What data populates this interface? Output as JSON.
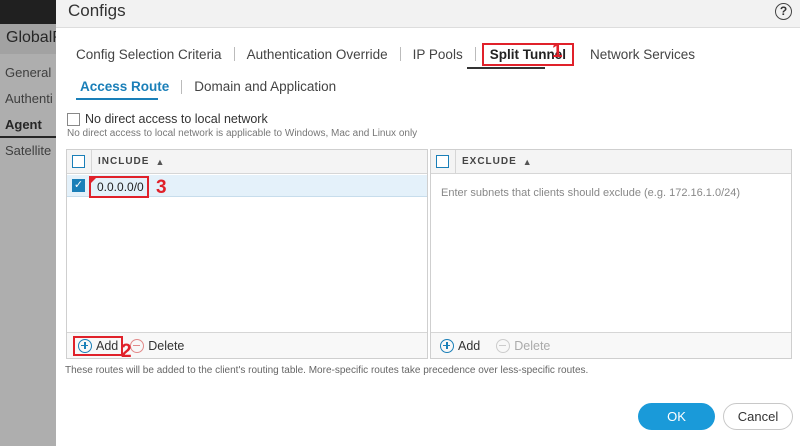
{
  "background_app": {
    "title": "GlobalP",
    "tabs": [
      "General",
      "Authenti",
      "Agent",
      "Satellite"
    ],
    "active_tab": "Agent"
  },
  "dialog": {
    "title": "Configs",
    "help_symbol": "?",
    "tabs": [
      {
        "label": "Config Selection Criteria"
      },
      {
        "label": "Authentication Override"
      },
      {
        "label": "IP Pools"
      },
      {
        "label": "Split Tunnel"
      },
      {
        "label": "Network Services"
      }
    ],
    "active_tab": "Split Tunnel",
    "subtabs": [
      {
        "label": "Access Route"
      },
      {
        "label": "Domain and Application"
      }
    ],
    "active_subtab": "Access Route",
    "no_direct_access": {
      "label": "No direct access to local network",
      "checked": false,
      "hint": "No direct access to local network is applicable to Windows, Mac and Linux only"
    },
    "include": {
      "header": "INCLUDE",
      "rows": [
        "0.0.0.0/0"
      ],
      "add_label": "Add",
      "delete_label": "Delete"
    },
    "exclude": {
      "header": "EXCLUDE",
      "placeholder": "Enter subnets that clients should exclude (e.g. 172.16.1.0/24)",
      "add_label": "Add",
      "delete_label": "Delete"
    },
    "routes_note": "These routes will be added to the client's routing table. More-specific routes take precedence over less-specific routes.",
    "ok_label": "OK",
    "cancel_label": "Cancel"
  },
  "annotations": [
    "1",
    "2",
    "3"
  ],
  "colors": {
    "accent": "#1a7fb8",
    "ok_button": "#1a9ad9",
    "annotation_red": "#e0212a",
    "selected_row": "#e4f1fa"
  }
}
